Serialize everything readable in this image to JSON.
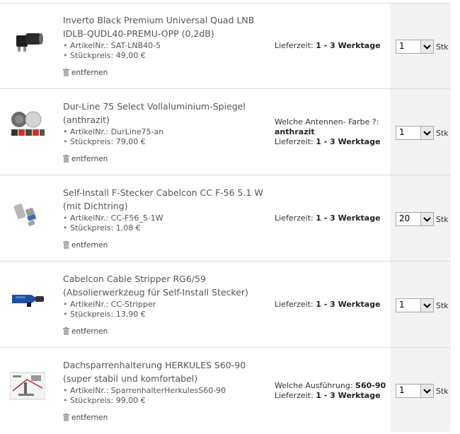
{
  "cart": {
    "items": [
      {
        "title_line1": "Inverto Black Premium Universal Quad LNB",
        "title_line2": "IDLB-QUDL40-PREMU-OPP (0,2dB)",
        "article_label": "ArtikelNr.:",
        "article_no": "SAT-LNB40-5",
        "price_label": "Stückpreis:",
        "price": "49,00 €",
        "remove": "entfernen",
        "option_label": "",
        "option_value": "",
        "delivery_label": "Lieferzeit:",
        "delivery": "1 - 3 Werktage",
        "qty": "1",
        "unit": "Stk",
        "image_icon": "lnb-product-icon"
      },
      {
        "title_line1": "Dur-Line 75 Select Vollaluminium-Spiegel",
        "title_line2": "(anthrazit)",
        "article_label": "ArtikelNr.:",
        "article_no": "DurLine75-an",
        "price_label": "Stückpreis:",
        "price": "79,00 €",
        "remove": "entfernen",
        "option_label": "Welche Antennen- Farbe ?:",
        "option_value": "anthrazit",
        "delivery_label": "Lieferzeit:",
        "delivery": "1 - 3 Werktage",
        "qty": "1",
        "unit": "Stk",
        "image_icon": "satellite-dish-product-icon"
      },
      {
        "title_line1": "Self-Install F-Stecker Cabelcon CC F-56 5.1 W",
        "title_line2": "(mit Dichtring)",
        "article_label": "ArtikelNr.:",
        "article_no": "CC-F56_5-1W",
        "price_label": "Stückpreis:",
        "price": "1,08 €",
        "remove": "entfernen",
        "option_label": "",
        "option_value": "",
        "delivery_label": "Lieferzeit:",
        "delivery": "1 - 3 Werktage",
        "qty": "20",
        "unit": "Stk",
        "image_icon": "f-connector-product-icon"
      },
      {
        "title_line1": "Cabelcon Cable Stripper RG6/59",
        "title_line2": "(Absolierwerkzeug für Self-Install Stecker)",
        "article_label": "ArtikelNr.:",
        "article_no": "CC-Stripper",
        "price_label": "Stückpreis:",
        "price": "13,90 €",
        "remove": "entfernen",
        "option_label": "",
        "option_value": "",
        "delivery_label": "Lieferzeit:",
        "delivery": "1 - 3 Werktage",
        "qty": "1",
        "unit": "Stk",
        "image_icon": "cable-stripper-product-icon"
      },
      {
        "title_line1": "Dachsparrenhalterung HERKULES S60-90",
        "title_line2": "(super stabil und komfortabel)",
        "article_label": "ArtikelNr.:",
        "article_no": "SparrenhalterHerkulesS60-90",
        "price_label": "Stückpreis:",
        "price": "99,00 €",
        "remove": "entfernen",
        "option_label": "Welche Ausführung:",
        "option_value": "S60-90",
        "delivery_label": "Lieferzeit:",
        "delivery": "1 - 3 Werktage",
        "qty": "1",
        "unit": "Stk",
        "image_icon": "roof-mount-product-icon"
      }
    ]
  }
}
